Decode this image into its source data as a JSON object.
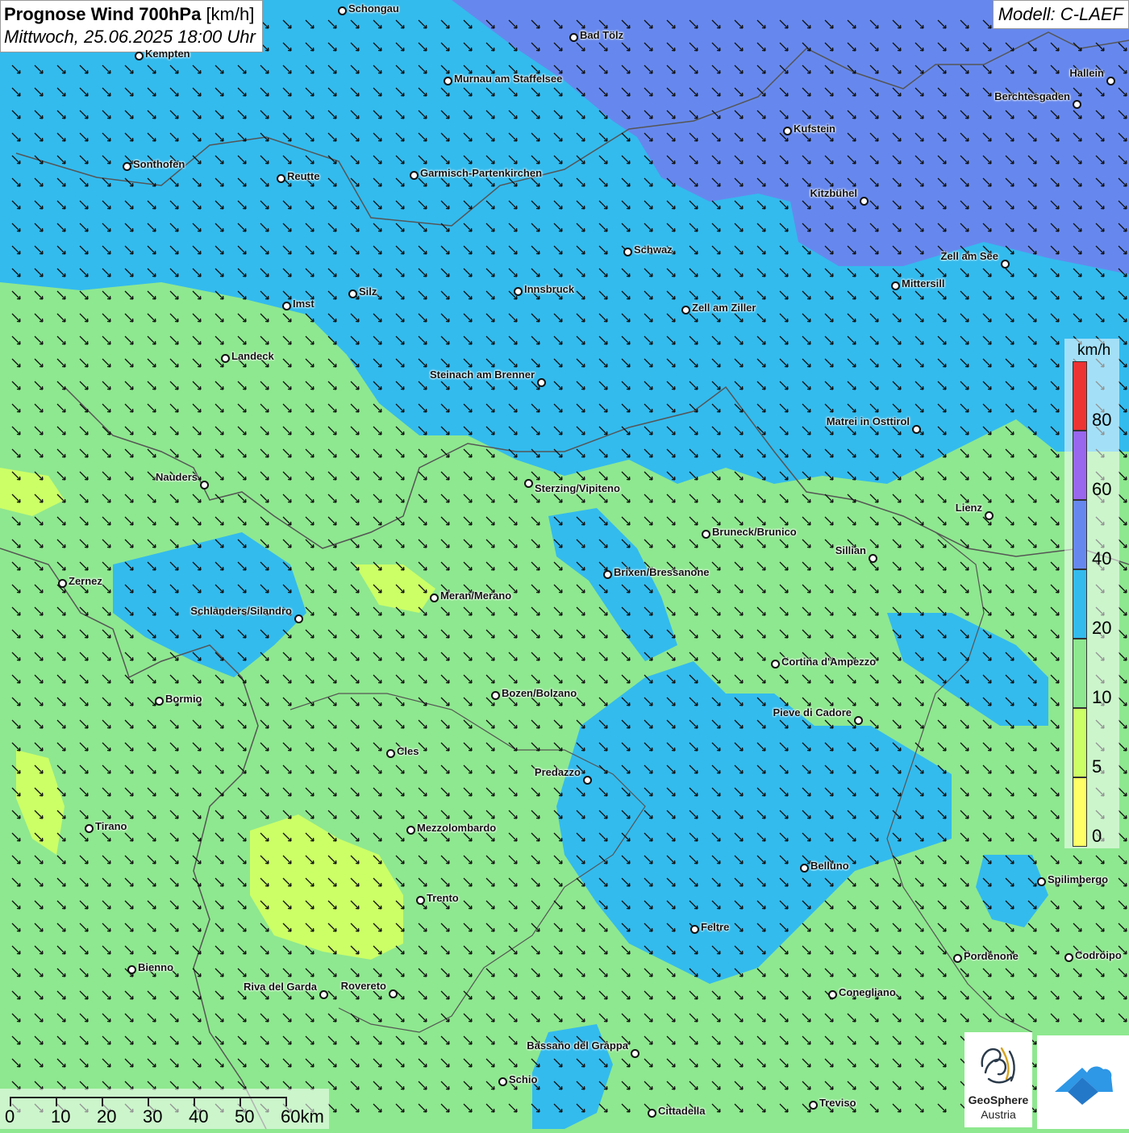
{
  "header": {
    "title_bold": "Prognose Wind 700hPa",
    "title_unit": "[km/h]",
    "subtitle": "Mittwoch, 25.06.2025 18:00 Uhr",
    "model": "Modell: C-LAEF"
  },
  "legend": {
    "unit": "km/h",
    "bands": [
      {
        "from": 0,
        "to": 5,
        "color": "#ffff66"
      },
      {
        "from": 5,
        "to": 10,
        "color": "#ccff66"
      },
      {
        "from": 10,
        "to": 20,
        "color": "#8ee88f"
      },
      {
        "from": 20,
        "to": 40,
        "color": "#33bbee"
      },
      {
        "from": 40,
        "to": 60,
        "color": "#6688ee"
      },
      {
        "from": 60,
        "to": 80,
        "color": "#9966ee"
      },
      {
        "from": 80,
        "to": 100,
        "color": "#ee3333"
      }
    ],
    "labels": [
      "0",
      "5",
      "10",
      "20",
      "40",
      "60",
      "80"
    ]
  },
  "scale_bar": {
    "labels": [
      "0",
      "10",
      "20",
      "30",
      "40",
      "50",
      "60km"
    ]
  },
  "wind_direction": "north-west to south-east",
  "colors": {
    "calm": "#8ee88f",
    "moderate": "#33bbee",
    "strong": "#6688ee",
    "weak": "#ccff66"
  },
  "cities": [
    {
      "name": "Schongau"
    },
    {
      "name": "Bad Tölz"
    },
    {
      "name": "Kempten"
    },
    {
      "name": "Murnau am Staffelsee"
    },
    {
      "name": "Hallein"
    },
    {
      "name": "Berchtesgaden"
    },
    {
      "name": "Kufstein"
    },
    {
      "name": "Sonthofen"
    },
    {
      "name": "Reutte"
    },
    {
      "name": "Garmisch-Partenkirchen"
    },
    {
      "name": "Kitzbühel"
    },
    {
      "name": "Schwaz"
    },
    {
      "name": "Zell am See"
    },
    {
      "name": "Mittersill"
    },
    {
      "name": "Innsbruck"
    },
    {
      "name": "Silz"
    },
    {
      "name": "Imst"
    },
    {
      "name": "Zell am Ziller"
    },
    {
      "name": "Landeck"
    },
    {
      "name": "Steinach am Brenner"
    },
    {
      "name": "Matrei in Osttirol"
    },
    {
      "name": "Nauders"
    },
    {
      "name": "Sterzing/Vipiteno"
    },
    {
      "name": "Lienz"
    },
    {
      "name": "Bruneck/Brunico"
    },
    {
      "name": "Sillian"
    },
    {
      "name": "Zernez"
    },
    {
      "name": "Brixen/Bressanone"
    },
    {
      "name": "Meran/Merano"
    },
    {
      "name": "Schlanders/Silandro"
    },
    {
      "name": "Cortina d'Ampezzo"
    },
    {
      "name": "Bormio"
    },
    {
      "name": "Bozen/Bolzano"
    },
    {
      "name": "Pieve di Cadore"
    },
    {
      "name": "Cles"
    },
    {
      "name": "Predazzo"
    },
    {
      "name": "Tirano"
    },
    {
      "name": "Mezzolombardo"
    },
    {
      "name": "Belluno"
    },
    {
      "name": "Spilimbergo"
    },
    {
      "name": "Trento"
    },
    {
      "name": "Feltre"
    },
    {
      "name": "Pordenone"
    },
    {
      "name": "Codroipo"
    },
    {
      "name": "Bienno"
    },
    {
      "name": "Riva del Garda"
    },
    {
      "name": "Rovereto"
    },
    {
      "name": "Conegliano"
    },
    {
      "name": "Bassano del Grappa"
    },
    {
      "name": "Schio"
    },
    {
      "name": "Treviso"
    },
    {
      "name": "Cittadella"
    }
  ],
  "logos": {
    "geosphere_line1": "GeoSphere",
    "geosphere_line2": "Austria"
  }
}
